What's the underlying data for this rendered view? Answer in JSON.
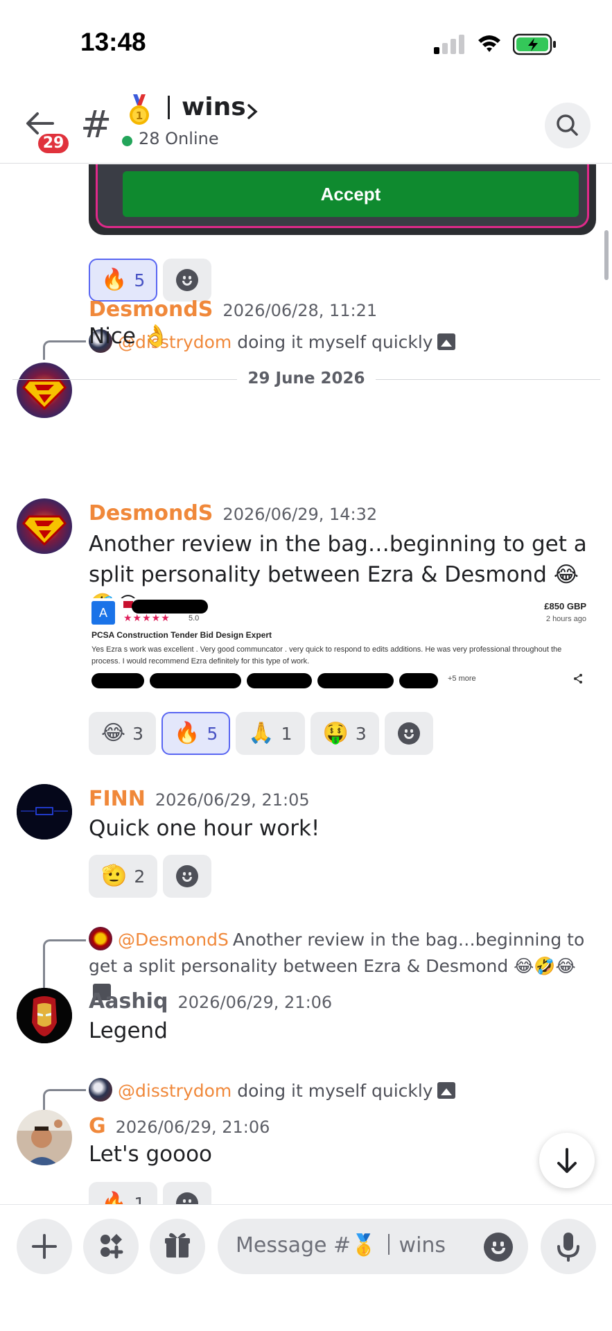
{
  "status_bar": {
    "time": "13:48"
  },
  "header": {
    "unread_count": "29",
    "channel_emoji": "🥇",
    "channel_name": "wins",
    "online": "28 Online"
  },
  "embed": {
    "accept_label": "Accept"
  },
  "messages": [
    {
      "reactions": [
        {
          "emoji": "🔥",
          "count": "5",
          "active": true
        }
      ]
    },
    {
      "reply": {
        "mention": "@disstrydom",
        "text": "doing it myself quickly"
      },
      "author": "DesmondS",
      "timestamp": "2026/06/28, 11:21",
      "text": "Nice 👌"
    },
    {
      "date_divider": "29 June 2026"
    },
    {
      "author": "DesmondS",
      "timestamp": "2026/06/29, 14:32",
      "text": "Another review in the bag…beginning to get a split personality between Ezra & Desmond 😂🤣😂",
      "attachment": {
        "logo": "A",
        "rating": "5.0",
        "price": "£850 GBP",
        "ago": "2 hours ago",
        "title": "PCSA Construction Tender Bid Design Expert",
        "body": "Yes Ezra s work was excellent . Very good communcator . very quick to respond to edits additions. He was very professional throughout the process. I would recommend Ezra definitely for this type of work.",
        "more": "+5 more"
      },
      "reactions": [
        {
          "emoji": "😂",
          "count": "3",
          "active": false
        },
        {
          "emoji": "🔥",
          "count": "5",
          "active": true
        },
        {
          "emoji": "🙏",
          "count": "1",
          "active": false
        },
        {
          "emoji": "🤑",
          "count": "3",
          "active": false
        }
      ]
    },
    {
      "author": "FINN",
      "timestamp": "2026/06/29, 21:05",
      "text": "Quick one hour work!",
      "reactions": [
        {
          "emoji": "🫡",
          "count": "2",
          "active": false
        }
      ]
    },
    {
      "reply": {
        "mention": "@DesmondS",
        "text": "Another review in the bag…beginning to get a split personality between Ezra & Desmond 😂🤣😂"
      },
      "author": "Aashiq",
      "timestamp": "2026/06/29, 21:06",
      "text": "Legend"
    },
    {
      "reply": {
        "mention": "@disstrydom",
        "text": "doing it myself quickly"
      },
      "author": "G",
      "timestamp": "2026/06/29, 21:06",
      "text": "Let's goooo",
      "reactions": [
        {
          "emoji": "🔥",
          "count": "1",
          "active": false
        }
      ]
    }
  ],
  "composer": {
    "placeholder_prefix": "Message #",
    "placeholder_emoji": "🥇",
    "placeholder_channel": "wins"
  },
  "icons": {
    "back": "arrow-left-icon",
    "hash": "hash-icon",
    "search": "search-icon",
    "plus": "plus-icon",
    "apps": "apps-icon",
    "gift": "gift-icon",
    "emoji": "emoji-icon",
    "mic": "microphone-icon",
    "scroll": "arrow-down-icon"
  },
  "colors": {
    "username": "#f0883a",
    "online": "#23a55a",
    "badge": "#e0323c",
    "accept": "#0f8a2f",
    "active_reaction": "#5865f2"
  }
}
